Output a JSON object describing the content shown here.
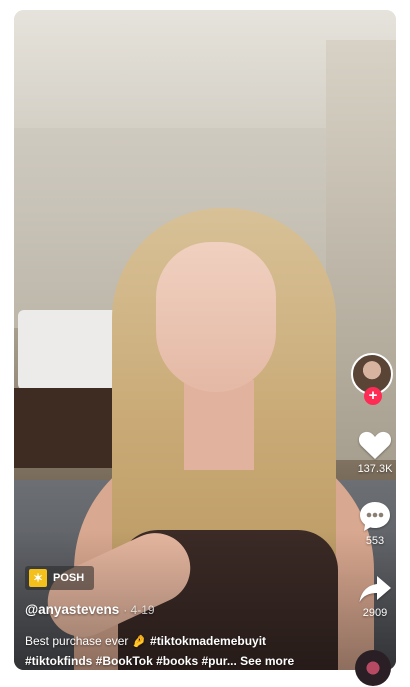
{
  "post": {
    "badge_label": "POSH",
    "author": "@anyastevens",
    "date": "· 4-19",
    "caption_text": "Best purchase ever 🤌",
    "caption_tags_line1": "#tiktokmademebuyit",
    "caption_tags_line2": "#tiktokfinds #BookTok #books #pur...",
    "see_more": "See more"
  },
  "actions": {
    "likes": "137.3K",
    "comments": "553",
    "shares": "2909"
  },
  "colors": {
    "follow": "#fe2c55",
    "badge_icon": "#f3c01c"
  },
  "icons": [
    "plus-icon",
    "heart-icon",
    "comment-icon",
    "share-icon",
    "spark-icon",
    "music-disc-icon"
  ]
}
